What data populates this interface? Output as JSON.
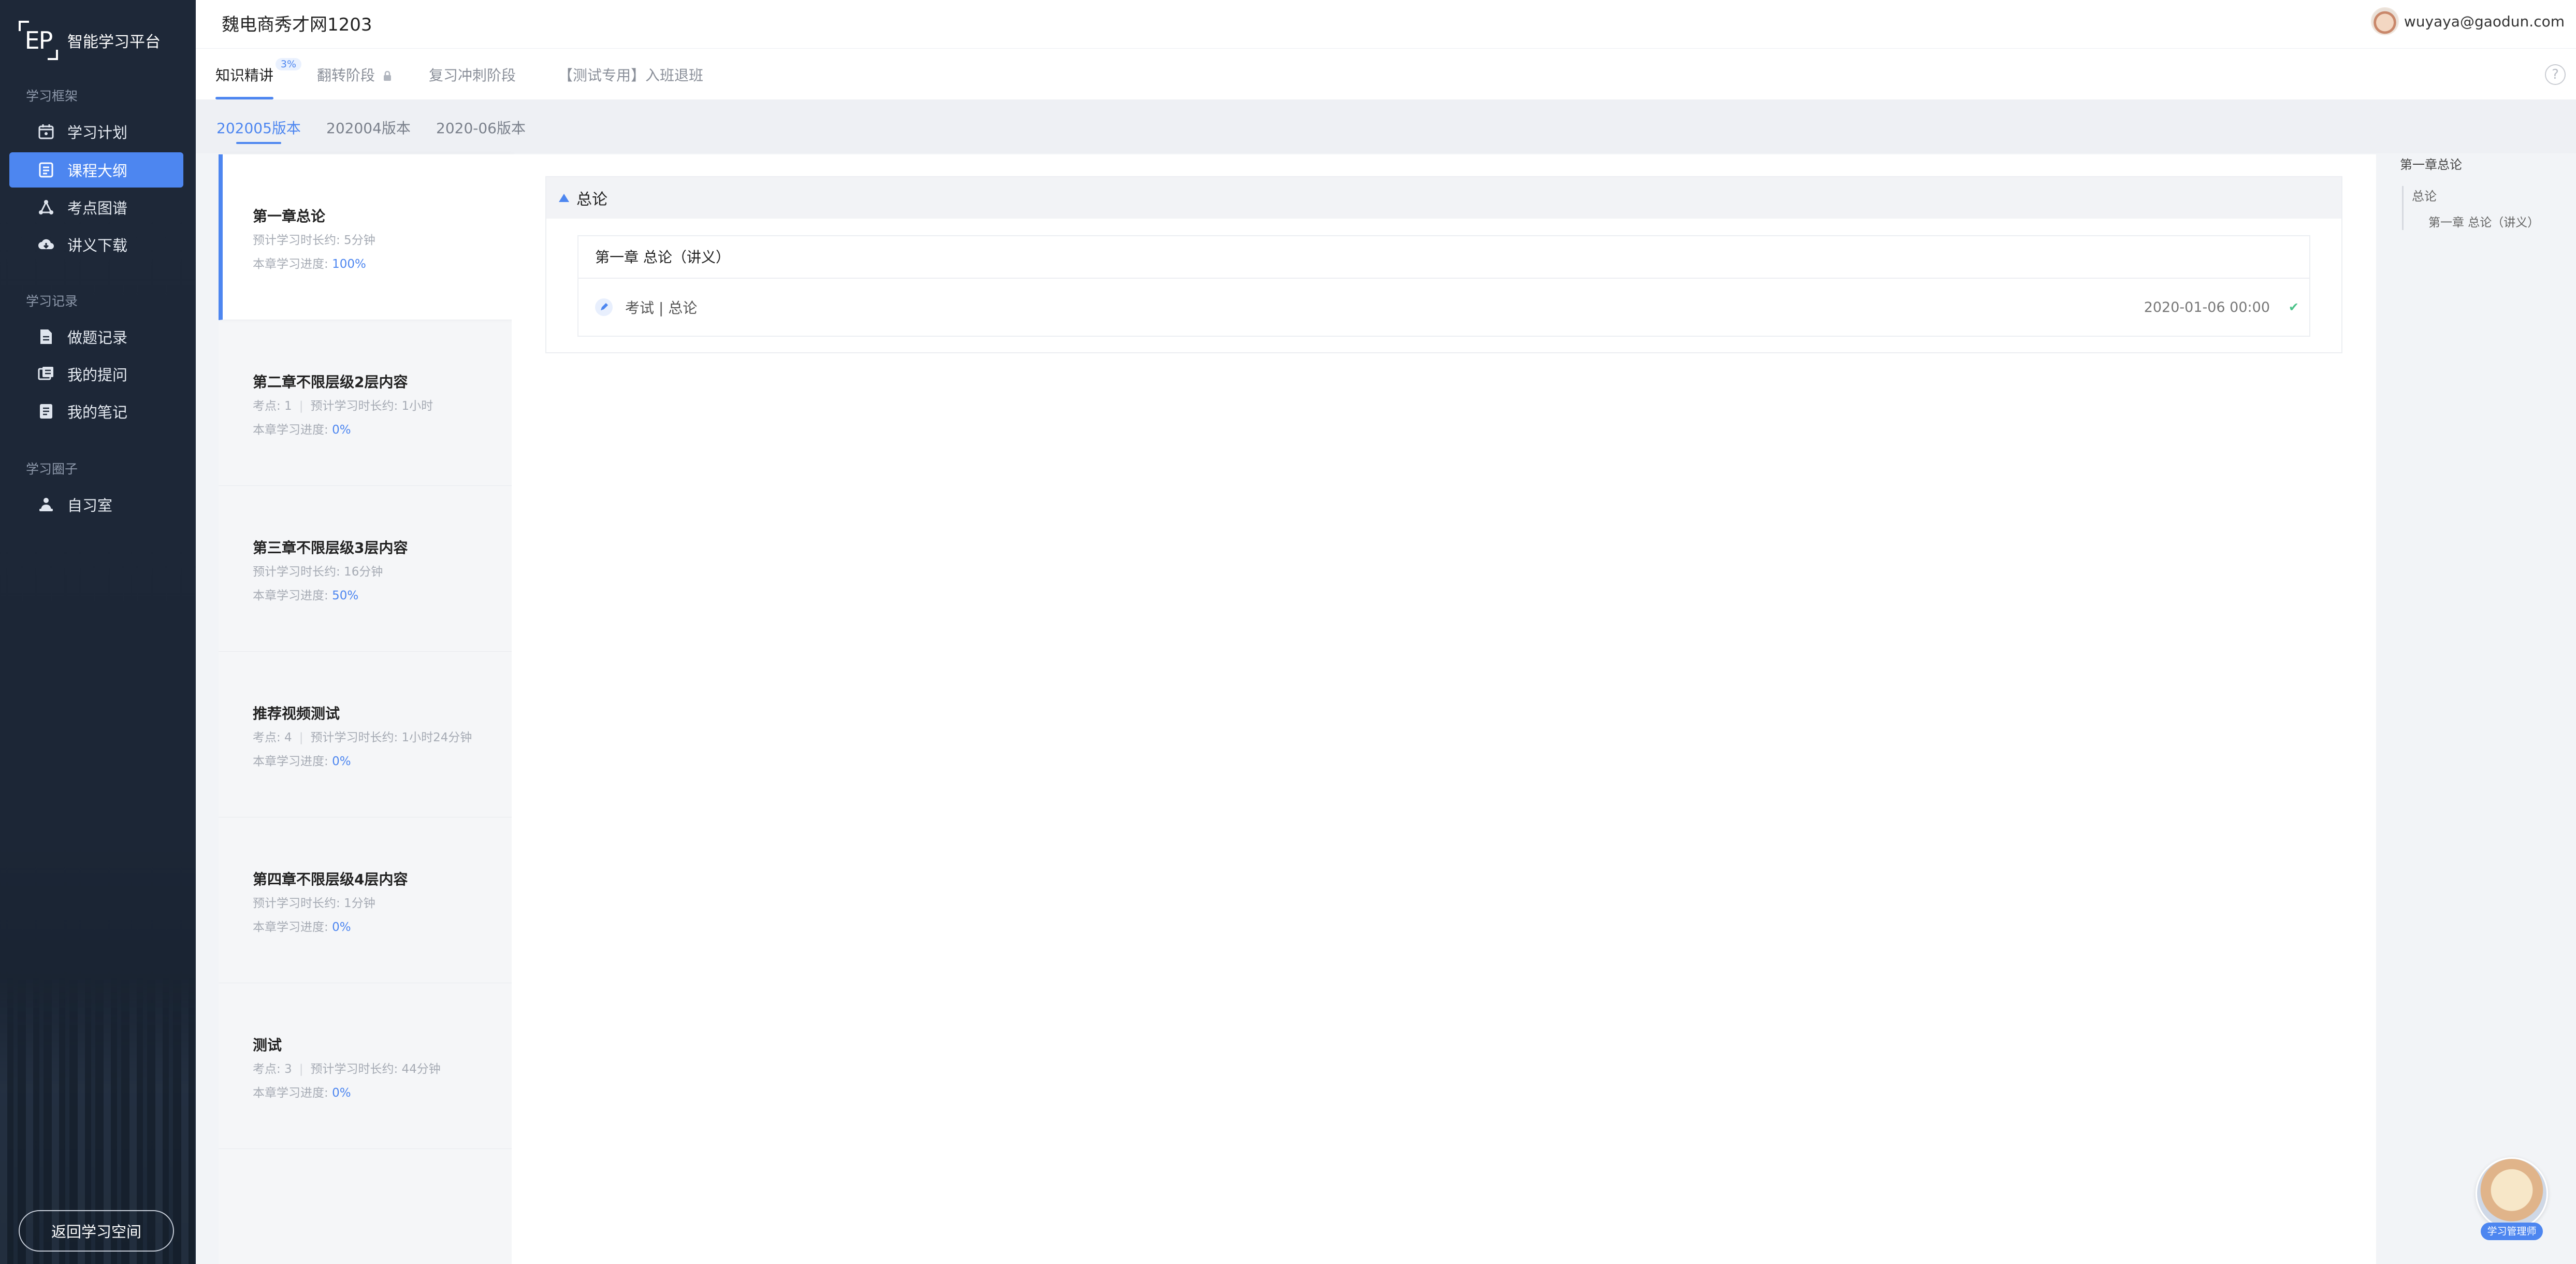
{
  "sidebar": {
    "brand_logo": "EP",
    "brand_name": "智能学习平台",
    "sections": [
      {
        "title": "学习框架",
        "items": [
          {
            "label": "学习计划",
            "icon": "calendar-icon",
            "active": false
          },
          {
            "label": "课程大纲",
            "icon": "outline-book-icon",
            "active": true
          },
          {
            "label": "考点图谱",
            "icon": "graph-icon",
            "active": false
          },
          {
            "label": "讲义下载",
            "icon": "cloud-download-icon",
            "active": false
          }
        ]
      },
      {
        "title": "学习记录",
        "items": [
          {
            "label": "做题记录",
            "icon": "document-icon",
            "active": false
          },
          {
            "label": "我的提问",
            "icon": "question-icon",
            "active": false
          },
          {
            "label": "我的笔记",
            "icon": "notes-icon",
            "active": false
          }
        ]
      },
      {
        "title": "学习圈子",
        "items": [
          {
            "label": "自习室",
            "icon": "study-room-icon",
            "active": false
          }
        ]
      }
    ],
    "back_button": "返回学习空间"
  },
  "header": {
    "course_title": "魏电商秀才网1203",
    "user_email": "wuyaya@gaodun.com"
  },
  "tabs": [
    {
      "label": "知识精讲",
      "badge": "3%",
      "active": true
    },
    {
      "label": "翻转阶段",
      "locked": true,
      "active": false
    },
    {
      "label": "复习冲刺阶段",
      "active": false
    },
    {
      "label": "【测试专用】入班退班",
      "active": false
    }
  ],
  "versions": [
    {
      "label": "202005版本",
      "active": true
    },
    {
      "label": "202004版本",
      "active": false
    },
    {
      "label": "2020-06版本",
      "active": false
    }
  ],
  "chapters": [
    {
      "title": "第一章总论",
      "points": "",
      "time": "预计学习时长约: 5分钟",
      "progress_label": "本章学习进度:",
      "progress": "100%",
      "active": true
    },
    {
      "title": "第二章不限层级2层内容",
      "points": "考点: 1",
      "time": "预计学习时长约: 1小时",
      "progress_label": "本章学习进度:",
      "progress": "0%",
      "active": false
    },
    {
      "title": "第三章不限层级3层内容",
      "points": "",
      "time": "预计学习时长约: 16分钟",
      "progress_label": "本章学习进度:",
      "progress": "50%",
      "active": false
    },
    {
      "title": "推荐视频测试",
      "points": "考点: 4",
      "time": "预计学习时长约: 1小时24分钟",
      "progress_label": "本章学习进度:",
      "progress": "0%",
      "active": false
    },
    {
      "title": "第四章不限层级4层内容",
      "points": "",
      "time": "预计学习时长约: 1分钟",
      "progress_label": "本章学习进度:",
      "progress": "0%",
      "active": false
    },
    {
      "title": "测试",
      "points": "考点: 3",
      "time": "预计学习时长约: 44分钟",
      "progress_label": "本章学习进度:",
      "progress": "0%",
      "active": false
    }
  ],
  "content": {
    "section_title": "总论",
    "lecture_title": "第一章 总论（讲义）",
    "item_label": "考试 | 总论",
    "item_date": "2020-01-06 00:00"
  },
  "outline": {
    "title": "第一章总论",
    "level1": "总论",
    "level2": "第一章 总论（讲义）"
  },
  "assistant": {
    "label": "学习管理师"
  },
  "colors": {
    "accent": "#4d86f0",
    "sidebar_bg": "#1e2838",
    "done_check": "#4cc38a"
  }
}
